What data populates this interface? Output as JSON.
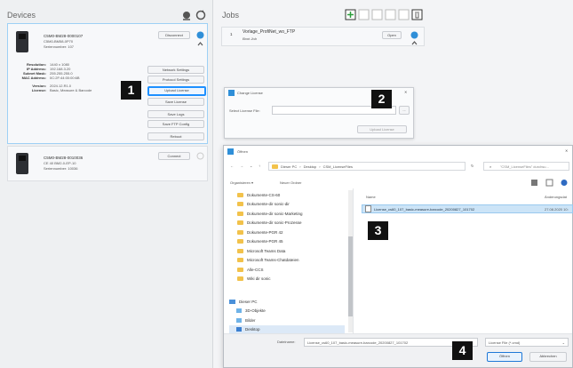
{
  "devices": {
    "title": "Devices",
    "device1": {
      "name": "C5M0-BM28-0000107",
      "model": "C5M0-BM58-0P70",
      "serial": "Seriennumber: 107",
      "disconnect": "Disconnect",
      "specs": [
        {
          "label": "Resolution:",
          "value": "1440 x 1080"
        },
        {
          "label": "IP Address:",
          "value": "192.168.3.20"
        },
        {
          "label": "Subnet Mask:",
          "value": "255.255.255.0"
        },
        {
          "label": "MAC Address:",
          "value": "0C:2F:44:00:00:6B"
        },
        {
          "label": "Version:",
          "value": "2024.12.R1.0"
        },
        {
          "label": "License:",
          "value": "Basic, Measure & Barcode"
        }
      ],
      "buttons": {
        "network": "Network Settings",
        "protocol": "Protocol Settings",
        "upload": "Upload License",
        "save_license": "Save License",
        "save_logs": "Save Logs",
        "save_ftp": "Save FTP Config",
        "reboot": "Reboot"
      }
    },
    "device2": {
      "name": "C5M0-BM28-0010036",
      "model": "CE 40 BM2-0-EP-10",
      "serial": "Seriennumber: 10036",
      "connect": "Connect"
    }
  },
  "jobs": {
    "title": "Jobs",
    "items": [
      {
        "index": "1",
        "name": "Vorlage_ProfiNet_wo_FTP",
        "sub": "Boot Job",
        "button": "Open"
      }
    ]
  },
  "change_license": {
    "title": "Change License",
    "label": "Select License File:",
    "browse": "...",
    "upload": "Upload License"
  },
  "file_dialog": {
    "title": "Öffnen",
    "path": [
      "Dieser PC",
      "Desktop",
      "CSM_LicenseFiles"
    ],
    "search_placeholder": "\"CSM_LicenseFiles\" durchsu...",
    "organize": "Organisieren ▾",
    "new_folder": "Neuer Ordner",
    "col_name": "Name",
    "col_date": "Änderungsdat",
    "file_name": "License_cs60_107_basic-measure-barcode_20200827_101702",
    "file_date": "27.08.2020 10:",
    "tree": [
      "Dokumente-CS-60",
      "Dokumente-dir sonic-dir",
      "Dokumente-dir sonic-Marketing",
      "Dokumente-dir sonic-Prozesse",
      "Dokumente-PGR 42",
      "Dokumente-PGR 45",
      "Microsoft Teams Data",
      "Microsoft Teams-Chatdateien",
      "Alle-CCS",
      "Wiki dir sonic"
    ],
    "pc_label": "Dieser PC",
    "pc_items": [
      "3D-Objekte",
      "Bilder",
      "Desktop"
    ],
    "filename_label": "Dateiname:",
    "filename_value": "License_cs60_107_basic-measure-barcode_20200827_101702",
    "filter": "License File (*.cmd)",
    "open": "Öffnen",
    "cancel": "Abbrechen"
  },
  "steps": [
    "1",
    "2",
    "3",
    "4"
  ],
  "colors": {
    "accent": "#1e90ff",
    "folder": "#f2c24b",
    "badge": "#111111"
  }
}
